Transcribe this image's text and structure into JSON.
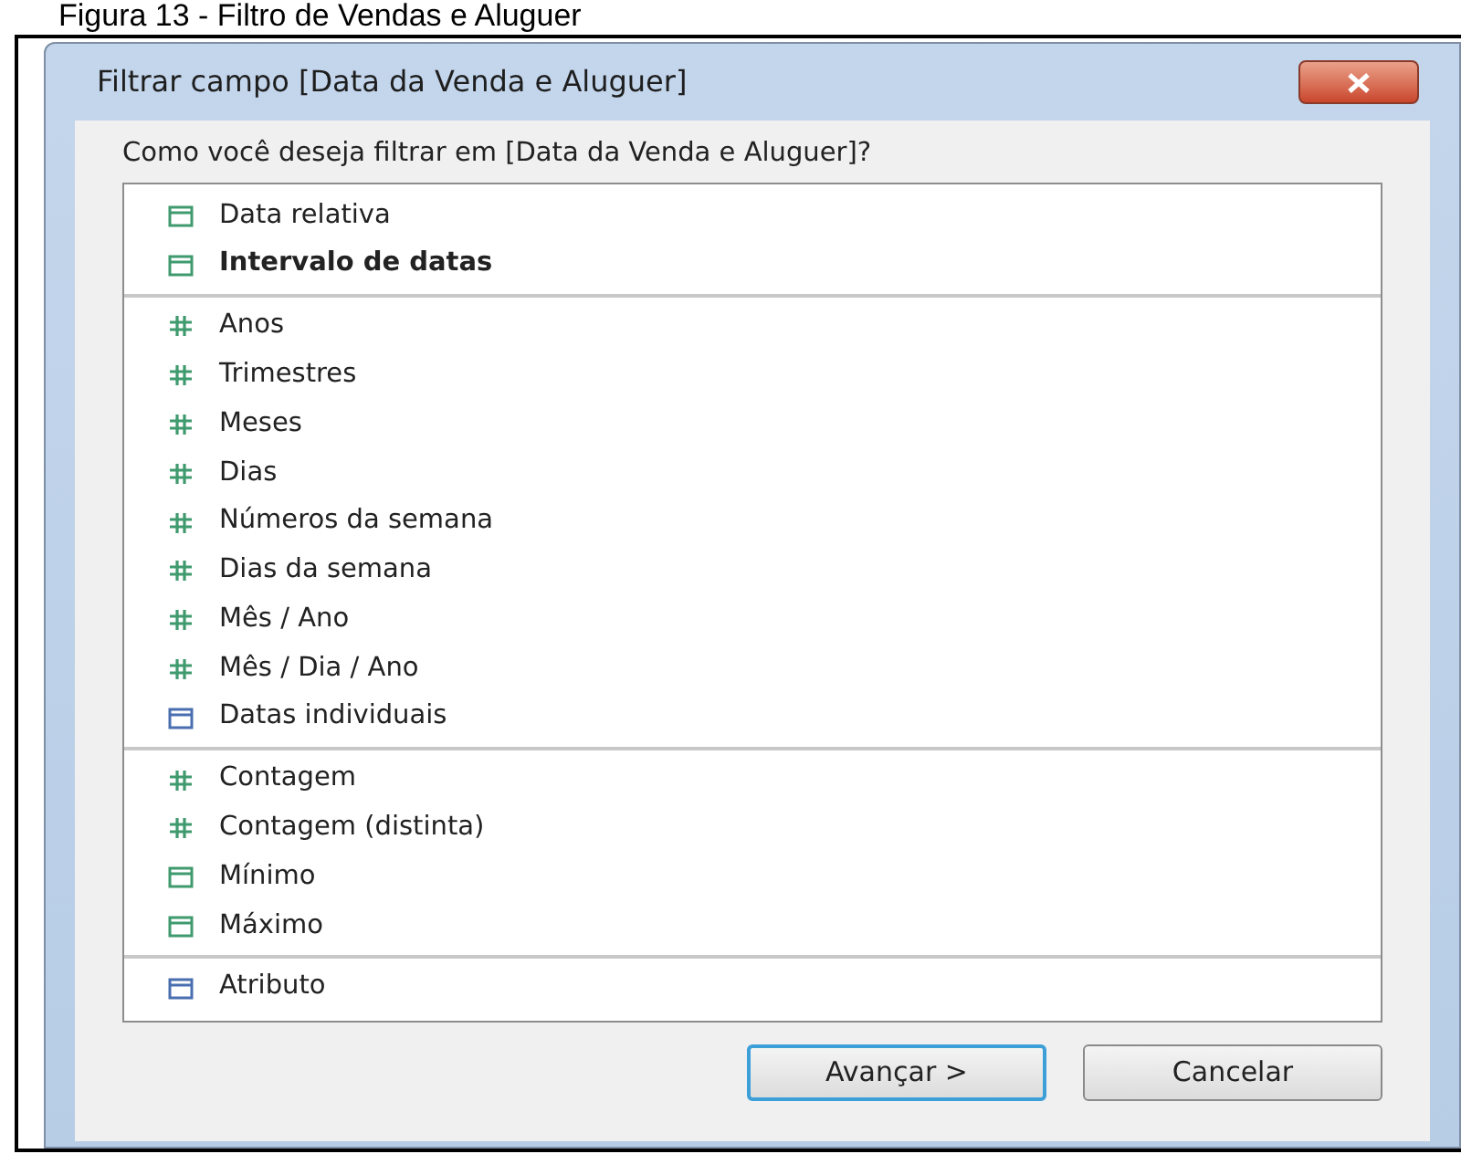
{
  "caption": "Figura 13 - Filtro de Vendas e Aluguer",
  "window": {
    "title": "Filtrar campo [Data da Venda e Aluguer]"
  },
  "prompt": "Como você deseja filtrar em [Data da Venda e Aluguer]?",
  "groups": [
    {
      "items": [
        {
          "label": "Data relativa",
          "kind": "calendar",
          "color": "#3f9a6e",
          "selected": false
        },
        {
          "label": "Intervalo de datas",
          "kind": "calendar",
          "color": "#3f9a6e",
          "selected": true
        }
      ]
    },
    {
      "items": [
        {
          "label": "Anos",
          "kind": "hash",
          "color": "#3f9a6e",
          "selected": false
        },
        {
          "label": "Trimestres",
          "kind": "hash",
          "color": "#3f9a6e",
          "selected": false
        },
        {
          "label": "Meses",
          "kind": "hash",
          "color": "#3f9a6e",
          "selected": false
        },
        {
          "label": "Dias",
          "kind": "hash",
          "color": "#3f9a6e",
          "selected": false
        },
        {
          "label": "Números da semana",
          "kind": "hash",
          "color": "#3f9a6e",
          "selected": false
        },
        {
          "label": "Dias da semana",
          "kind": "hash",
          "color": "#3f9a6e",
          "selected": false
        },
        {
          "label": "Mês / Ano",
          "kind": "hash",
          "color": "#3f9a6e",
          "selected": false
        },
        {
          "label": "Mês / Dia / Ano",
          "kind": "hash",
          "color": "#3f9a6e",
          "selected": false
        },
        {
          "label": "Datas individuais",
          "kind": "calendar",
          "color": "#4a6fb0",
          "selected": false
        }
      ]
    },
    {
      "items": [
        {
          "label": "Contagem",
          "kind": "hash",
          "color": "#3f9a6e",
          "selected": false
        },
        {
          "label": "Contagem (distinta)",
          "kind": "hash",
          "color": "#3f9a6e",
          "selected": false
        },
        {
          "label": "Mínimo",
          "kind": "calendar",
          "color": "#3f9a6e",
          "selected": false
        },
        {
          "label": "Máximo",
          "kind": "calendar",
          "color": "#3f9a6e",
          "selected": false
        }
      ]
    },
    {
      "items": [
        {
          "label": "Atributo",
          "kind": "calendar",
          "color": "#4a6fb0",
          "selected": false
        }
      ]
    }
  ],
  "buttons": [
    {
      "label": "Avançar >",
      "default": true
    },
    {
      "label": "Cancelar",
      "default": false
    }
  ]
}
